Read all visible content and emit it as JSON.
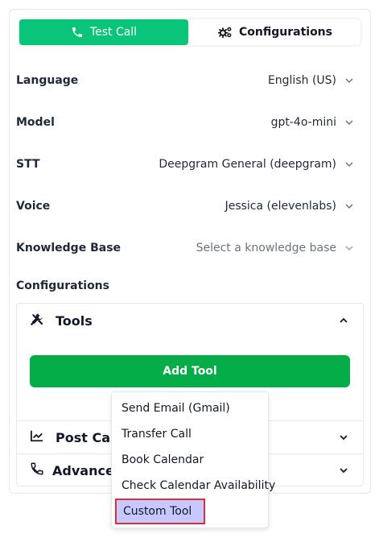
{
  "tabs": [
    {
      "label": "Test Call",
      "icon": "phone-icon",
      "active": true
    },
    {
      "label": "Configurations",
      "icon": "gears-icon",
      "active": false
    }
  ],
  "settings": [
    {
      "label": "Language",
      "value": "English (US)"
    },
    {
      "label": "Model",
      "value": "gpt-4o-mini"
    },
    {
      "label": "STT",
      "value": "Deepgram General (deepgram)"
    },
    {
      "label": "Voice",
      "value": "Jessica (elevenlabs)"
    },
    {
      "label": "Knowledge Base",
      "placeholder": "Select a knowledge base"
    }
  ],
  "configurations_title": "Configurations",
  "accordion": {
    "tools": {
      "title": "Tools",
      "icon": "tools-icon",
      "expanded": true,
      "add_button": "Add Tool"
    },
    "post_call": {
      "title": "Post Call",
      "icon": "chart-line-icon"
    },
    "advanced": {
      "title": "Advance S",
      "icon": "phone-icon"
    }
  },
  "dropdown": {
    "items": [
      "Send Email (Gmail)",
      "Transfer Call",
      "Book Calendar",
      "Check Calendar Availability",
      "Custom Tool"
    ],
    "highlighted": "Custom Tool"
  },
  "colors": {
    "tab_active": "#0ac47a",
    "add_button": "#04ad48",
    "highlight_bg": "#c7c8ff",
    "highlight_border": "#e22b3b"
  }
}
